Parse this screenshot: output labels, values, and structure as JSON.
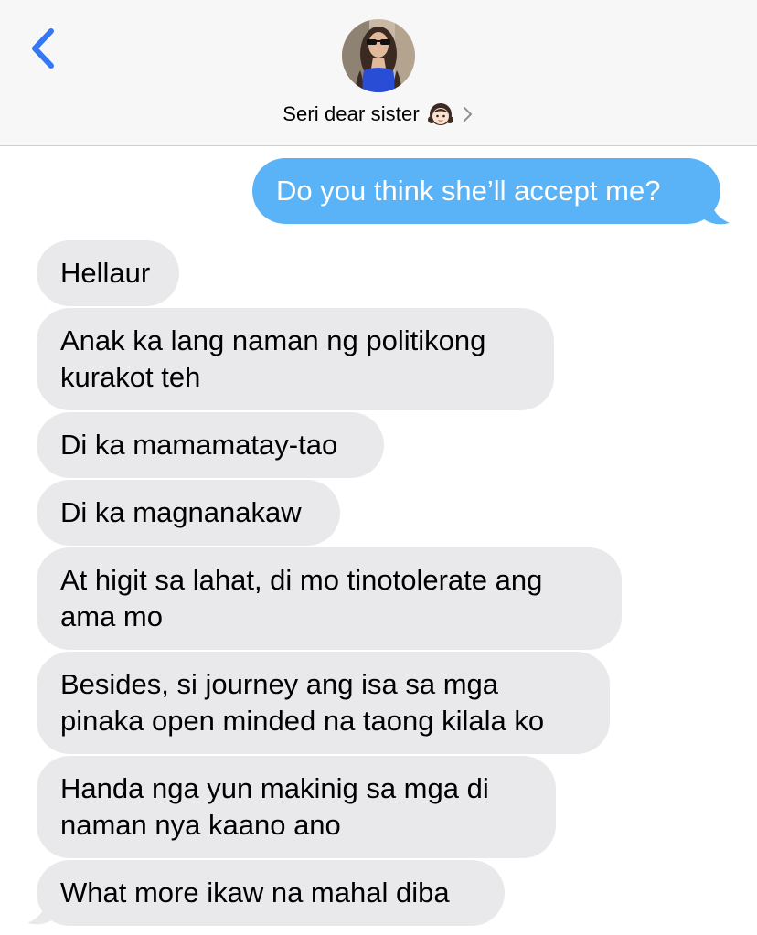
{
  "header": {
    "back_icon": "chevron-left-icon",
    "contact_name": "Seri dear sister",
    "contact_emoji": "girl-emoji",
    "disclosure_icon": "chevron-right-icon"
  },
  "colors": {
    "header_bg": "#f7f7f7",
    "accent": "#3478f6",
    "outgoing_bubble": "#5ab3f6",
    "incoming_bubble": "#e9e9eb"
  },
  "messages": [
    {
      "direction": "outgoing",
      "text": "Do you think she’ll accept me?"
    },
    {
      "direction": "incoming",
      "text": "Hellaur"
    },
    {
      "direction": "incoming",
      "lines": [
        "Anak ka lang naman ng politikong",
        "kurakot teh"
      ]
    },
    {
      "direction": "incoming",
      "text": "Di ka mamamatay-tao"
    },
    {
      "direction": "incoming",
      "text": "Di ka magnanakaw"
    },
    {
      "direction": "incoming",
      "lines": [
        "At higit sa lahat, di mo tinotolerate ang",
        "ama mo"
      ]
    },
    {
      "direction": "incoming",
      "lines": [
        "Besides, si journey ang isa sa mga",
        "pinaka open minded na taong kilala ko"
      ]
    },
    {
      "direction": "incoming",
      "lines": [
        "Handa nga yun makinig sa mga di",
        "naman nya kaano ano"
      ]
    },
    {
      "direction": "incoming",
      "text": "What more ikaw na mahal diba"
    }
  ]
}
